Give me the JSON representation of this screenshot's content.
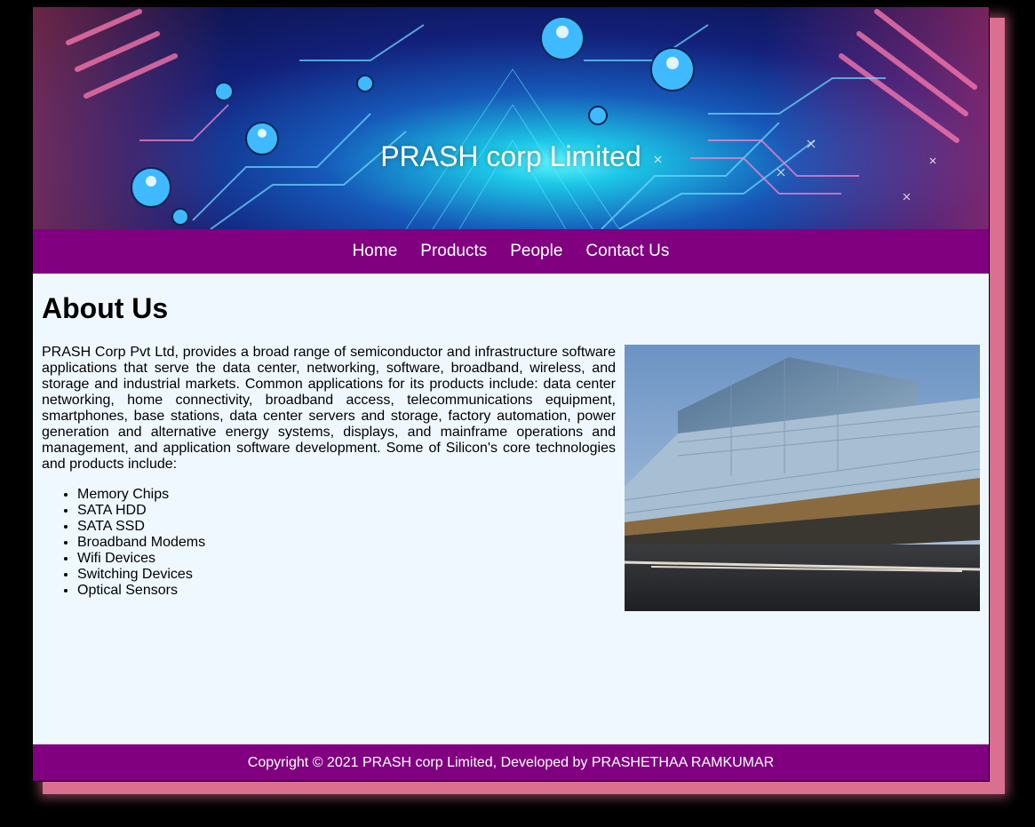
{
  "banner": {
    "title": "PRASH corp Limited"
  },
  "nav": {
    "items": [
      "Home",
      "Products",
      "People",
      "Contact Us"
    ]
  },
  "about": {
    "heading": "About Us",
    "paragraph": "PRASH Corp Pvt Ltd, provides a broad range of semiconductor and infrastructure software applications that serve the data center, networking, software, broadband, wireless, and storage and industrial markets. Common applications for its products include: data center networking, home connectivity, broadband access, telecommunications equipment, smartphones, base stations, data center servers and storage, factory automation, power generation and alternative energy systems, displays, and mainframe operations and management, and application software development. Some of Silicon's core technologies and products include:",
    "technologies": [
      "Memory Chips",
      "SATA HDD",
      "SATA SSD",
      "Broadband Modems",
      "Wifi Devices",
      "Switching Devices",
      "Optical Sensors"
    ]
  },
  "footer": {
    "text": "Copyright © 2021 PRASH corp Limited, Developed by PRASHETHAA RAMKUMAR"
  },
  "colors": {
    "nav_bg": "#800080",
    "content_bg": "#f0f8ff",
    "page_shadow": "#d9708f"
  }
}
